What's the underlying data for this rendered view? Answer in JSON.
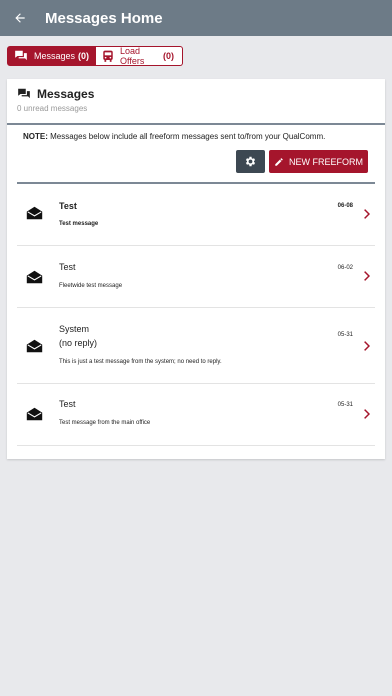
{
  "appbar": {
    "title": "Messages Home"
  },
  "tabs": [
    {
      "label": "Messages",
      "count": "(0)"
    },
    {
      "label": "Load Offers",
      "count": "(0)"
    }
  ],
  "card": {
    "title": "Messages",
    "subtitle": "0 unread messages",
    "note_prefix": "NOTE:",
    "note_text": " Messages below include all freeform messages sent to/from your QualComm.",
    "new_button": "NEW FREEFORM"
  },
  "messages": [
    {
      "subject": "Test",
      "subject2": "",
      "preview": "Test message",
      "date": "06-08"
    },
    {
      "subject": "Test",
      "subject2": "",
      "preview": "Fleetwide test message",
      "date": "06-02"
    },
    {
      "subject": "System",
      "subject2": "(no reply)",
      "preview": "This is just a test message from the system; no need to reply.",
      "date": "05-31"
    },
    {
      "subject": "Test",
      "subject2": "",
      "preview": "Test message from the main office",
      "date": "05-31"
    }
  ],
  "colors": {
    "appbar": "#6d7b87",
    "accent": "#a5152c",
    "settings": "#3d4852",
    "background": "#e8e9ec"
  }
}
